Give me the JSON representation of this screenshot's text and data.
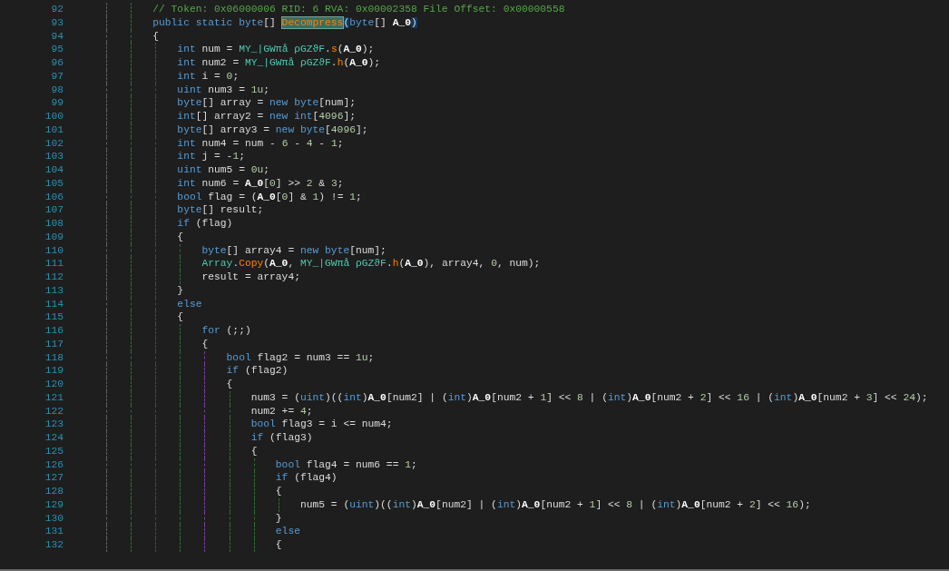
{
  "editor": {
    "lines": [
      {
        "number": "92",
        "tokens": [
          {
            "text": "        // Token: 0x06000006 RID: 6 RVA: 0x00002358 File Offset: 0x00000558",
            "kind": "comment"
          }
        ]
      },
      {
        "number": "93",
        "tokens": [
          {
            "text": "        public static byte",
            "kind": "keyword"
          },
          {
            "text": "[] ",
            "kind": "plain"
          },
          {
            "text": "Decompress",
            "kind": "method",
            "highlighted": true
          },
          {
            "text": "(",
            "kind": "plain",
            "brace_matched": true
          },
          {
            "text": "byte",
            "kind": "keyword"
          },
          {
            "text": "[] ",
            "kind": "plain"
          },
          {
            "text": "A_0",
            "kind": "param"
          },
          {
            "text": ")",
            "kind": "plain",
            "brace_matched": true
          }
        ]
      },
      {
        "number": "94",
        "tokens": [
          {
            "text": "        {",
            "kind": "plain"
          }
        ]
      },
      {
        "number": "95",
        "tokens": [
          {
            "text": "            int",
            "kind": "keyword"
          },
          {
            "text": " num = ",
            "kind": "plain"
          },
          {
            "text": "MY_|GWπå ρGZϑF",
            "kind": "type"
          },
          {
            "text": ".",
            "kind": "plain"
          },
          {
            "text": "s",
            "kind": "method"
          },
          {
            "text": "(",
            "kind": "plain"
          },
          {
            "text": "A_0",
            "kind": "param"
          },
          {
            "text": ");",
            "kind": "plain"
          }
        ]
      },
      {
        "number": "96",
        "tokens": [
          {
            "text": "            int",
            "kind": "keyword"
          },
          {
            "text": " num2 = ",
            "kind": "plain"
          },
          {
            "text": "MY_|GWπå ρGZϑF",
            "kind": "type"
          },
          {
            "text": ".",
            "kind": "plain"
          },
          {
            "text": "h",
            "kind": "method"
          },
          {
            "text": "(",
            "kind": "plain"
          },
          {
            "text": "A_0",
            "kind": "param"
          },
          {
            "text": ");",
            "kind": "plain"
          }
        ]
      },
      {
        "number": "97",
        "tokens": [
          {
            "text": "            int",
            "kind": "keyword"
          },
          {
            "text": " i = ",
            "kind": "plain"
          },
          {
            "text": "0",
            "kind": "number"
          },
          {
            "text": ";",
            "kind": "plain"
          }
        ]
      },
      {
        "number": "98",
        "tokens": [
          {
            "text": "            uint",
            "kind": "keyword"
          },
          {
            "text": " num3 = ",
            "kind": "plain"
          },
          {
            "text": "1u",
            "kind": "number"
          },
          {
            "text": ";",
            "kind": "plain"
          }
        ]
      },
      {
        "number": "99",
        "tokens": [
          {
            "text": "            byte",
            "kind": "keyword"
          },
          {
            "text": "[] array = ",
            "kind": "plain"
          },
          {
            "text": "new byte",
            "kind": "keyword"
          },
          {
            "text": "[num];",
            "kind": "plain"
          }
        ]
      },
      {
        "number": "100",
        "tokens": [
          {
            "text": "            int",
            "kind": "keyword"
          },
          {
            "text": "[] array2 = ",
            "kind": "plain"
          },
          {
            "text": "new int",
            "kind": "keyword"
          },
          {
            "text": "[",
            "kind": "plain"
          },
          {
            "text": "4096",
            "kind": "number"
          },
          {
            "text": "];",
            "kind": "plain"
          }
        ]
      },
      {
        "number": "101",
        "tokens": [
          {
            "text": "            byte",
            "kind": "keyword"
          },
          {
            "text": "[] array3 = ",
            "kind": "plain"
          },
          {
            "text": "new byte",
            "kind": "keyword"
          },
          {
            "text": "[",
            "kind": "plain"
          },
          {
            "text": "4096",
            "kind": "number"
          },
          {
            "text": "];",
            "kind": "plain"
          }
        ]
      },
      {
        "number": "102",
        "tokens": [
          {
            "text": "            int",
            "kind": "keyword"
          },
          {
            "text": " num4 = num - ",
            "kind": "plain"
          },
          {
            "text": "6",
            "kind": "number"
          },
          {
            "text": " - ",
            "kind": "plain"
          },
          {
            "text": "4",
            "kind": "number"
          },
          {
            "text": " - ",
            "kind": "plain"
          },
          {
            "text": "1",
            "kind": "number"
          },
          {
            "text": ";",
            "kind": "plain"
          }
        ]
      },
      {
        "number": "103",
        "tokens": [
          {
            "text": "            int",
            "kind": "keyword"
          },
          {
            "text": " j = -",
            "kind": "plain"
          },
          {
            "text": "1",
            "kind": "number"
          },
          {
            "text": ";",
            "kind": "plain"
          }
        ]
      },
      {
        "number": "104",
        "tokens": [
          {
            "text": "            uint",
            "kind": "keyword"
          },
          {
            "text": " num5 = ",
            "kind": "plain"
          },
          {
            "text": "0u",
            "kind": "number"
          },
          {
            "text": ";",
            "kind": "plain"
          }
        ]
      },
      {
        "number": "105",
        "tokens": [
          {
            "text": "            int",
            "kind": "keyword"
          },
          {
            "text": " num6 = ",
            "kind": "plain"
          },
          {
            "text": "A_0",
            "kind": "param"
          },
          {
            "text": "[",
            "kind": "plain"
          },
          {
            "text": "0",
            "kind": "number"
          },
          {
            "text": "] >> ",
            "kind": "plain"
          },
          {
            "text": "2",
            "kind": "number"
          },
          {
            "text": " & ",
            "kind": "plain"
          },
          {
            "text": "3",
            "kind": "number"
          },
          {
            "text": ";",
            "kind": "plain"
          }
        ]
      },
      {
        "number": "106",
        "tokens": [
          {
            "text": "            bool",
            "kind": "keyword"
          },
          {
            "text": " flag = (",
            "kind": "plain"
          },
          {
            "text": "A_0",
            "kind": "param"
          },
          {
            "text": "[",
            "kind": "plain"
          },
          {
            "text": "0",
            "kind": "number"
          },
          {
            "text": "] & ",
            "kind": "plain"
          },
          {
            "text": "1",
            "kind": "number"
          },
          {
            "text": ") != ",
            "kind": "plain"
          },
          {
            "text": "1",
            "kind": "number"
          },
          {
            "text": ";",
            "kind": "plain"
          }
        ]
      },
      {
        "number": "107",
        "tokens": [
          {
            "text": "            byte",
            "kind": "keyword"
          },
          {
            "text": "[] result;",
            "kind": "plain"
          }
        ]
      },
      {
        "number": "108",
        "tokens": [
          {
            "text": "            if",
            "kind": "keyword"
          },
          {
            "text": " (flag)",
            "kind": "plain"
          }
        ]
      },
      {
        "number": "109",
        "tokens": [
          {
            "text": "            {",
            "kind": "plain"
          }
        ]
      },
      {
        "number": "110",
        "tokens": [
          {
            "text": "                byte",
            "kind": "keyword"
          },
          {
            "text": "[] array4 = ",
            "kind": "plain"
          },
          {
            "text": "new byte",
            "kind": "keyword"
          },
          {
            "text": "[num];",
            "kind": "plain"
          }
        ]
      },
      {
        "number": "111",
        "tokens": [
          {
            "text": "                Array",
            "kind": "type"
          },
          {
            "text": ".",
            "kind": "plain"
          },
          {
            "text": "Copy",
            "kind": "method"
          },
          {
            "text": "(",
            "kind": "plain"
          },
          {
            "text": "A_0",
            "kind": "param"
          },
          {
            "text": ", ",
            "kind": "plain"
          },
          {
            "text": "MY_|GWπå ρGZϑF",
            "kind": "type"
          },
          {
            "text": ".",
            "kind": "plain"
          },
          {
            "text": "h",
            "kind": "method"
          },
          {
            "text": "(",
            "kind": "plain"
          },
          {
            "text": "A_0",
            "kind": "param"
          },
          {
            "text": "), array4, ",
            "kind": "plain"
          },
          {
            "text": "0",
            "kind": "number"
          },
          {
            "text": ", num);",
            "kind": "plain"
          }
        ]
      },
      {
        "number": "112",
        "tokens": [
          {
            "text": "                result = array4;",
            "kind": "plain"
          }
        ]
      },
      {
        "number": "113",
        "tokens": [
          {
            "text": "            }",
            "kind": "plain"
          }
        ]
      },
      {
        "number": "114",
        "tokens": [
          {
            "text": "            else",
            "kind": "keyword"
          }
        ]
      },
      {
        "number": "115",
        "tokens": [
          {
            "text": "            {",
            "kind": "plain"
          }
        ]
      },
      {
        "number": "116",
        "tokens": [
          {
            "text": "                for",
            "kind": "keyword"
          },
          {
            "text": " (;;)",
            "kind": "plain"
          }
        ]
      },
      {
        "number": "117",
        "tokens": [
          {
            "text": "                {",
            "kind": "plain"
          }
        ]
      },
      {
        "number": "118",
        "tokens": [
          {
            "text": "                    bool",
            "kind": "keyword"
          },
          {
            "text": " flag2 = num3 == ",
            "kind": "plain"
          },
          {
            "text": "1u",
            "kind": "number"
          },
          {
            "text": ";",
            "kind": "plain"
          }
        ]
      },
      {
        "number": "119",
        "tokens": [
          {
            "text": "                    if",
            "kind": "keyword"
          },
          {
            "text": " (flag2)",
            "kind": "plain"
          }
        ]
      },
      {
        "number": "120",
        "tokens": [
          {
            "text": "                    {",
            "kind": "plain"
          }
        ]
      },
      {
        "number": "121",
        "tokens": [
          {
            "text": "                        num3 = (",
            "kind": "plain"
          },
          {
            "text": "uint",
            "kind": "keyword"
          },
          {
            "text": ")((",
            "kind": "plain"
          },
          {
            "text": "int",
            "kind": "keyword"
          },
          {
            "text": ")",
            "kind": "plain"
          },
          {
            "text": "A_0",
            "kind": "param"
          },
          {
            "text": "[num2] | (",
            "kind": "plain"
          },
          {
            "text": "int",
            "kind": "keyword"
          },
          {
            "text": ")",
            "kind": "plain"
          },
          {
            "text": "A_0",
            "kind": "param"
          },
          {
            "text": "[num2 + ",
            "kind": "plain"
          },
          {
            "text": "1",
            "kind": "number"
          },
          {
            "text": "] << ",
            "kind": "plain"
          },
          {
            "text": "8",
            "kind": "number"
          },
          {
            "text": " | (",
            "kind": "plain"
          },
          {
            "text": "int",
            "kind": "keyword"
          },
          {
            "text": ")",
            "kind": "plain"
          },
          {
            "text": "A_0",
            "kind": "param"
          },
          {
            "text": "[num2 + ",
            "kind": "plain"
          },
          {
            "text": "2",
            "kind": "number"
          },
          {
            "text": "] << ",
            "kind": "plain"
          },
          {
            "text": "16",
            "kind": "number"
          },
          {
            "text": " | (",
            "kind": "plain"
          },
          {
            "text": "int",
            "kind": "keyword"
          },
          {
            "text": ")",
            "kind": "plain"
          },
          {
            "text": "A_0",
            "kind": "param"
          },
          {
            "text": "[num2 + ",
            "kind": "plain"
          },
          {
            "text": "3",
            "kind": "number"
          },
          {
            "text": "] << ",
            "kind": "plain"
          },
          {
            "text": "24",
            "kind": "number"
          },
          {
            "text": ");",
            "kind": "plain"
          }
        ]
      },
      {
        "number": "122",
        "tokens": [
          {
            "text": "                        num2 += ",
            "kind": "plain"
          },
          {
            "text": "4",
            "kind": "number"
          },
          {
            "text": ";",
            "kind": "plain"
          }
        ]
      },
      {
        "number": "123",
        "tokens": [
          {
            "text": "                        bool",
            "kind": "keyword"
          },
          {
            "text": " flag3 = i <= num4;",
            "kind": "plain"
          }
        ]
      },
      {
        "number": "124",
        "tokens": [
          {
            "text": "                        if",
            "kind": "keyword"
          },
          {
            "text": " (flag3)",
            "kind": "plain"
          }
        ]
      },
      {
        "number": "125",
        "tokens": [
          {
            "text": "                        {",
            "kind": "plain"
          }
        ]
      },
      {
        "number": "126",
        "tokens": [
          {
            "text": "                            bool",
            "kind": "keyword"
          },
          {
            "text": " flag4 = num6 == ",
            "kind": "plain"
          },
          {
            "text": "1",
            "kind": "number"
          },
          {
            "text": ";",
            "kind": "plain"
          }
        ]
      },
      {
        "number": "127",
        "tokens": [
          {
            "text": "                            if",
            "kind": "keyword"
          },
          {
            "text": " (flag4)",
            "kind": "plain"
          }
        ]
      },
      {
        "number": "128",
        "tokens": [
          {
            "text": "                            {",
            "kind": "plain"
          }
        ]
      },
      {
        "number": "129",
        "tokens": [
          {
            "text": "                                num5 = (",
            "kind": "plain"
          },
          {
            "text": "uint",
            "kind": "keyword"
          },
          {
            "text": ")((",
            "kind": "plain"
          },
          {
            "text": "int",
            "kind": "keyword"
          },
          {
            "text": ")",
            "kind": "plain"
          },
          {
            "text": "A_0",
            "kind": "param"
          },
          {
            "text": "[num2] | (",
            "kind": "plain"
          },
          {
            "text": "int",
            "kind": "keyword"
          },
          {
            "text": ")",
            "kind": "plain"
          },
          {
            "text": "A_0",
            "kind": "param"
          },
          {
            "text": "[num2 + ",
            "kind": "plain"
          },
          {
            "text": "1",
            "kind": "number"
          },
          {
            "text": "] << ",
            "kind": "plain"
          },
          {
            "text": "8",
            "kind": "number"
          },
          {
            "text": " | (",
            "kind": "plain"
          },
          {
            "text": "int",
            "kind": "keyword"
          },
          {
            "text": ")",
            "kind": "plain"
          },
          {
            "text": "A_0",
            "kind": "param"
          },
          {
            "text": "[num2 + ",
            "kind": "plain"
          },
          {
            "text": "2",
            "kind": "number"
          },
          {
            "text": "] << ",
            "kind": "plain"
          },
          {
            "text": "16",
            "kind": "number"
          },
          {
            "text": ");",
            "kind": "plain"
          }
        ]
      },
      {
        "number": "130",
        "tokens": [
          {
            "text": "                            }",
            "kind": "plain"
          }
        ]
      },
      {
        "number": "131",
        "tokens": [
          {
            "text": "                            else",
            "kind": "keyword"
          }
        ]
      },
      {
        "number": "132",
        "tokens": [
          {
            "text": "                            {",
            "kind": "plain"
          }
        ]
      }
    ]
  }
}
